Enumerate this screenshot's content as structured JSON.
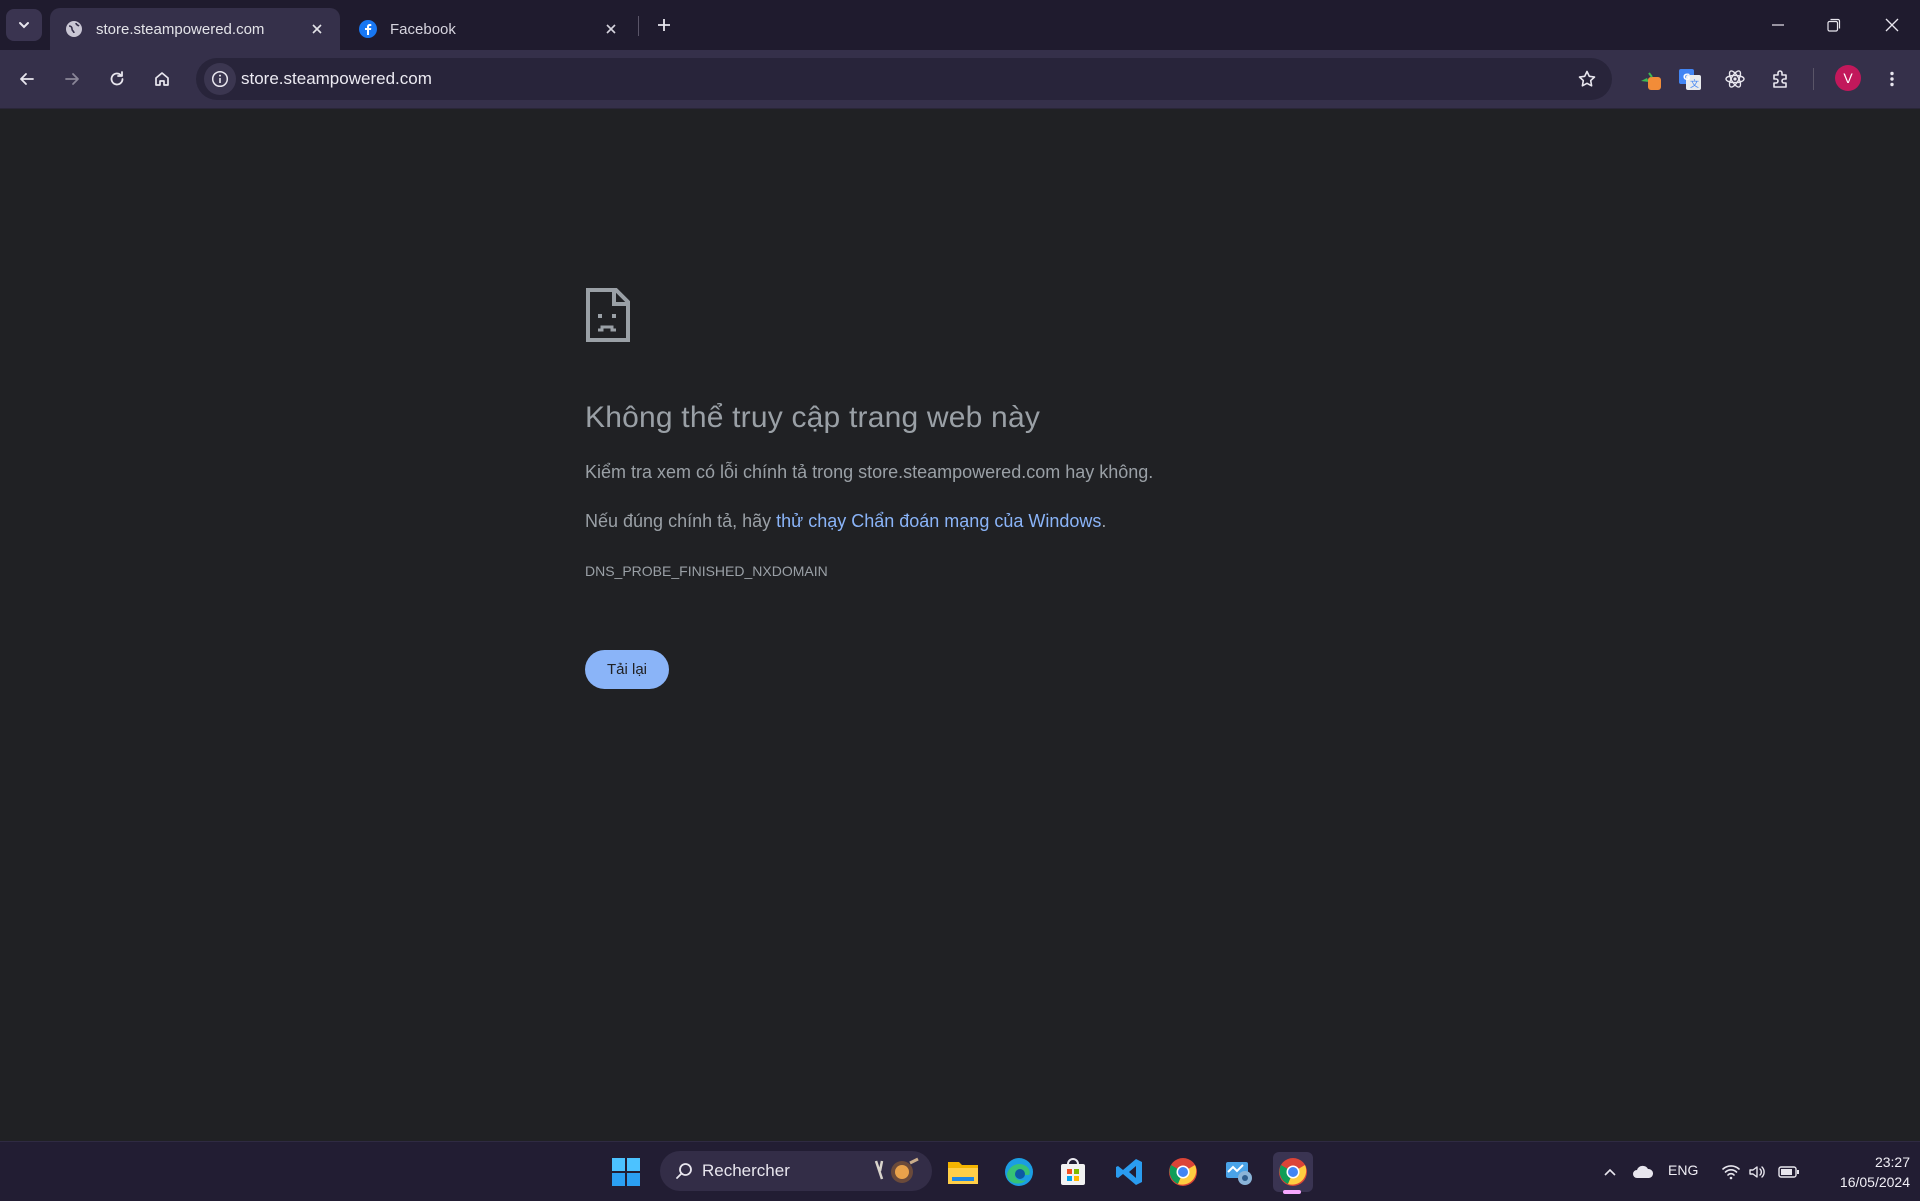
{
  "browser": {
    "tabs": [
      {
        "title": "store.steampowered.com",
        "favicon": "globe-icon",
        "active": true
      },
      {
        "title": "Facebook",
        "favicon": "facebook-icon",
        "active": false
      }
    ],
    "url": "store.steampowered.com",
    "profile_initial": "V"
  },
  "error_page": {
    "title": "Không thể truy cập trang web này",
    "line1": "Kiểm tra xem có lỗi chính tả trong store.steampowered.com hay không.",
    "line2_prefix": "Nếu đúng chính tả, hãy ",
    "line2_link": "thử chạy Chẩn đoán mạng của Windows",
    "line2_suffix": ".",
    "error_code": "DNS_PROBE_FINISHED_NXDOMAIN",
    "reload_label": "Tải lại"
  },
  "taskbar": {
    "search_placeholder": "Rechercher",
    "language": "ENG",
    "time": "23:27",
    "date": "16/05/2024"
  },
  "colors": {
    "accent_blue": "#8ab4f8",
    "page_background": "#202124",
    "frame": "#35304a"
  }
}
